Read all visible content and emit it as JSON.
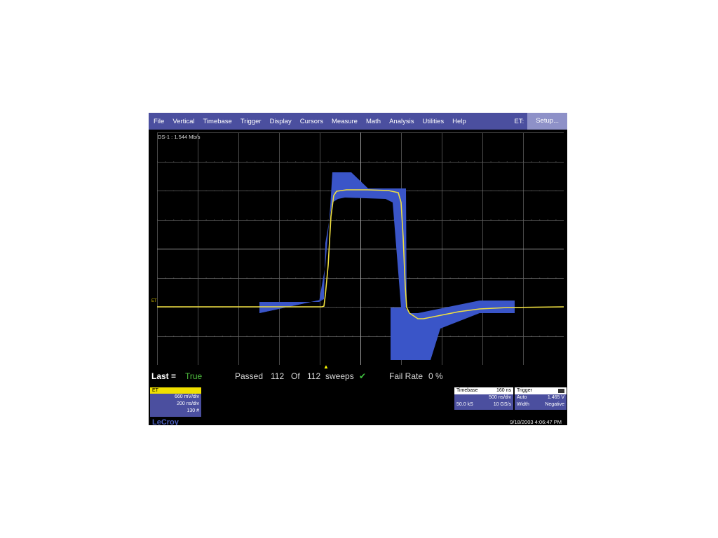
{
  "menu": {
    "items": [
      "File",
      "Vertical",
      "Timebase",
      "Trigger",
      "Display",
      "Cursors",
      "Measure",
      "Math",
      "Analysis",
      "Utilities",
      "Help"
    ],
    "et_label": "ET:",
    "setup_label": "Setup..."
  },
  "grid": {
    "ds_label": "DS-1 : 1.544 Mb/s",
    "et_marker": "ET"
  },
  "status": {
    "last_label": "Last =",
    "last_value": "True",
    "passed_label": "Passed",
    "passed_count": "112",
    "of_label": "Of",
    "total_count": "112",
    "sweeps_label": "sweeps",
    "check_icon": "✔",
    "failrate_label": "Fail Rate",
    "failrate_value": "0 %"
  },
  "channel": {
    "name": "ET",
    "volts_div": "660 mV/div",
    "time_div": "200 ns/div",
    "count": "130 #"
  },
  "timebase": {
    "label": "Timebase",
    "delay": "160 ns",
    "time_div": "500 ns/div",
    "samples": "50.0 kS",
    "rate": "10 GS/s"
  },
  "trigger": {
    "label": "Trigger",
    "mode": "Auto",
    "level": "1.465 V",
    "type": "Width",
    "polarity": "Negative"
  },
  "brand": "LeCroy",
  "timestamp": "9/18/2003 4:06:47 PM",
  "colors": {
    "trace": "#f0e040",
    "mask": "#3a55c8",
    "menubar": "#4b4f9f",
    "pass": "#4fbf3f"
  }
}
